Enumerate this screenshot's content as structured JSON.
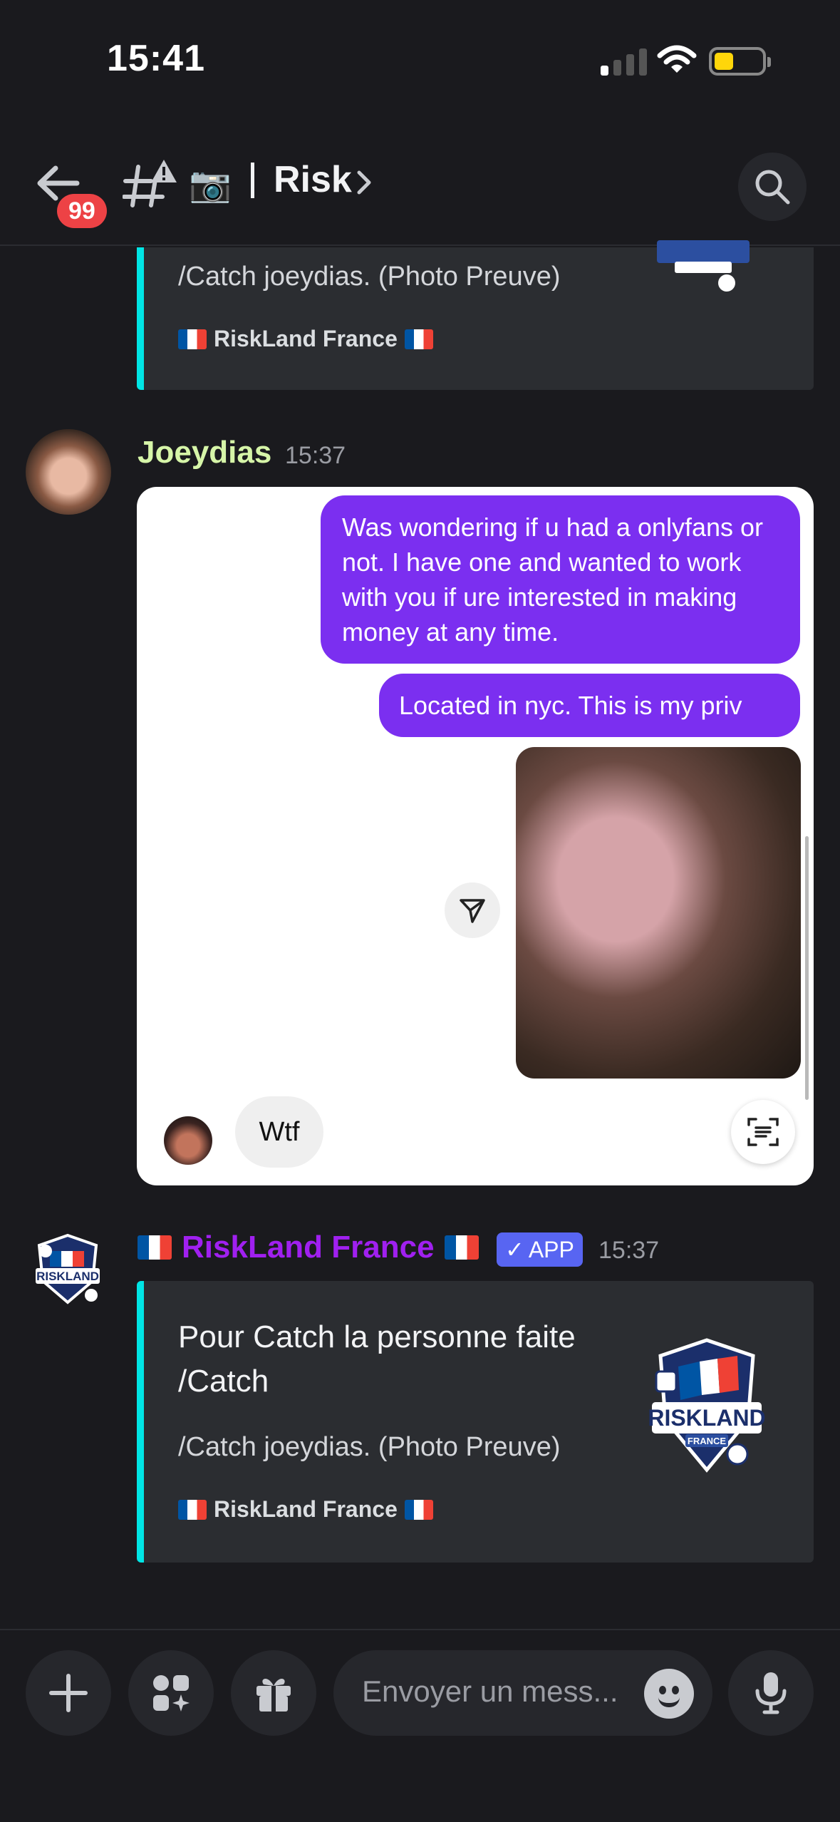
{
  "status_bar": {
    "time": "15:41"
  },
  "header": {
    "unread_count": "99",
    "channel_emoji": "📷",
    "channel_name": "Risk",
    "back_icon": "back-arrow-icon",
    "search_icon": "search-icon"
  },
  "messages": [
    {
      "type": "embed",
      "description": "/Catch joeydias. (Photo Preuve)",
      "footer": "RiskLand France"
    },
    {
      "type": "user",
      "username": "Joeydias",
      "timestamp": "15:37",
      "attachment": {
        "bubbles": [
          "Was wondering if u had a onlyfans or not. I have one and wanted to work with you if ure interested in making money at any time.",
          "Located in nyc. This is my priv"
        ],
        "reply": "Wtf"
      }
    },
    {
      "type": "bot",
      "username": "RiskLand France",
      "badge": "APP",
      "timestamp": "15:37",
      "embed": {
        "title": "Pour Catch la personne faite /Catch",
        "description": "/Catch joeydias. (Photo Preuve)",
        "footer": "RiskLand France",
        "logo_text": "RISKLAND",
        "logo_subtext": "FRANCE"
      }
    }
  ],
  "composer": {
    "placeholder": "Envoyer un mess..."
  },
  "colors": {
    "background": "#1a1a1e",
    "embed_bg": "#2b2d31",
    "embed_accent": "#00e5e5",
    "user_name": "#d6f5a8",
    "bot_name": "#a020f0",
    "bubble": "#7b2ff0",
    "app_badge": "#5865f2",
    "unread_badge": "#ed4245"
  }
}
